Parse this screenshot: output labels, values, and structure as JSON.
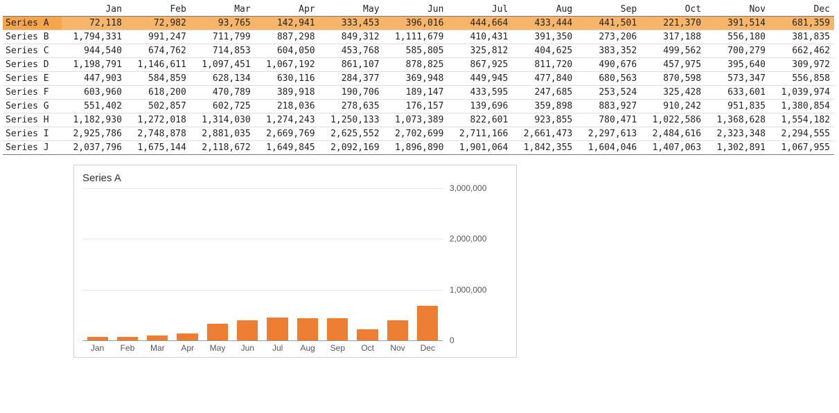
{
  "months": [
    "Jan",
    "Feb",
    "Mar",
    "Apr",
    "May",
    "Jun",
    "Jul",
    "Aug",
    "Sep",
    "Oct",
    "Nov",
    "Dec"
  ],
  "series": [
    {
      "name": "Series A",
      "selected": true,
      "values": [
        72118,
        72982,
        93765,
        142941,
        333453,
        396016,
        444664,
        433444,
        441501,
        221370,
        391514,
        681359
      ]
    },
    {
      "name": "Series B",
      "selected": false,
      "values": [
        1794331,
        991247,
        711799,
        887298,
        849312,
        1111679,
        410431,
        391350,
        273206,
        317188,
        556180,
        381835
      ]
    },
    {
      "name": "Series C",
      "selected": false,
      "values": [
        944540,
        674762,
        714853,
        604050,
        453768,
        585805,
        325812,
        404625,
        383352,
        499562,
        700279,
        662462
      ]
    },
    {
      "name": "Series D",
      "selected": false,
      "values": [
        1198791,
        1146611,
        1097451,
        1067192,
        861107,
        878825,
        867925,
        811720,
        490676,
        457975,
        395640,
        309972
      ]
    },
    {
      "name": "Series E",
      "selected": false,
      "values": [
        447903,
        584859,
        628134,
        630116,
        284377,
        369948,
        449945,
        477840,
        680563,
        870598,
        573347,
        556858
      ]
    },
    {
      "name": "Series F",
      "selected": false,
      "values": [
        603960,
        618200,
        470789,
        389918,
        190706,
        189147,
        433595,
        247685,
        253524,
        325428,
        633601,
        1039974
      ]
    },
    {
      "name": "Series G",
      "selected": false,
      "values": [
        551402,
        502857,
        602725,
        218036,
        278635,
        176157,
        139696,
        359898,
        883927,
        910242,
        951835,
        1380854
      ]
    },
    {
      "name": "Series H",
      "selected": false,
      "values": [
        1182930,
        1272018,
        1314030,
        1274243,
        1250133,
        1073389,
        822601,
        923855,
        780471,
        1022586,
        1368628,
        1554182
      ]
    },
    {
      "name": "Series I",
      "selected": false,
      "values": [
        2925786,
        2748878,
        2881035,
        2669769,
        2625552,
        2702699,
        2711166,
        2661473,
        2297613,
        2484616,
        2323348,
        2294555
      ]
    },
    {
      "name": "Series J",
      "selected": false,
      "values": [
        2037796,
        1675144,
        2118672,
        1649845,
        2092169,
        1896890,
        1901064,
        1842355,
        1604046,
        1407063,
        1302891,
        1067955
      ]
    }
  ],
  "chart_data": {
    "type": "bar",
    "title": "Series A",
    "categories": [
      "Jan",
      "Feb",
      "Mar",
      "Apr",
      "May",
      "Jun",
      "Jul",
      "Aug",
      "Sep",
      "Oct",
      "Nov",
      "Dec"
    ],
    "values": [
      72118,
      72982,
      93765,
      142941,
      333453,
      396016,
      444664,
      433444,
      441501,
      221370,
      391514,
      681359
    ],
    "ylim": [
      0,
      3000000
    ],
    "yticks": [
      0,
      1000000,
      2000000,
      3000000
    ],
    "xlabel": "",
    "ylabel": "",
    "bar_color": "#ed7d31",
    "grid": true
  }
}
